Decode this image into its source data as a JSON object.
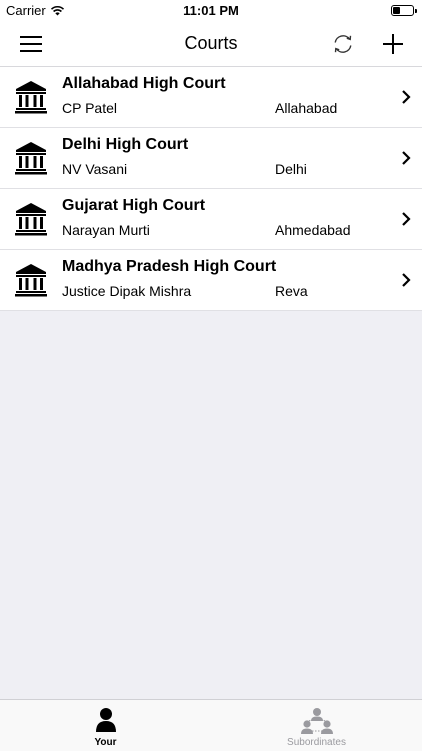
{
  "status_bar": {
    "carrier": "Carrier",
    "time": "11:01 PM",
    "battery_level": 0.35
  },
  "nav": {
    "title": "Courts",
    "menu_icon": "hamburger-menu-icon",
    "refresh_icon": "refresh-icon",
    "add_icon": "plus-icon"
  },
  "courts": [
    {
      "name": "Allahabad High Court",
      "judge": "CP Patel",
      "city": "Allahabad"
    },
    {
      "name": "Delhi High Court",
      "judge": "NV Vasani",
      "city": "Delhi"
    },
    {
      "name": "Gujarat High Court",
      "judge": "Narayan Murti",
      "city": "Ahmedabad"
    },
    {
      "name": "Madhya Pradesh High Court",
      "judge": "Justice Dipak Mishra",
      "city": "Reva"
    }
  ],
  "tabs": [
    {
      "label": "Your",
      "icon": "person-icon",
      "active": true
    },
    {
      "label": "Subordinates",
      "icon": "group-icon",
      "active": false
    }
  ],
  "colors": {
    "background": "#efeff4",
    "active_tab": "#000000",
    "inactive_tab": "#9a9a9f"
  }
}
